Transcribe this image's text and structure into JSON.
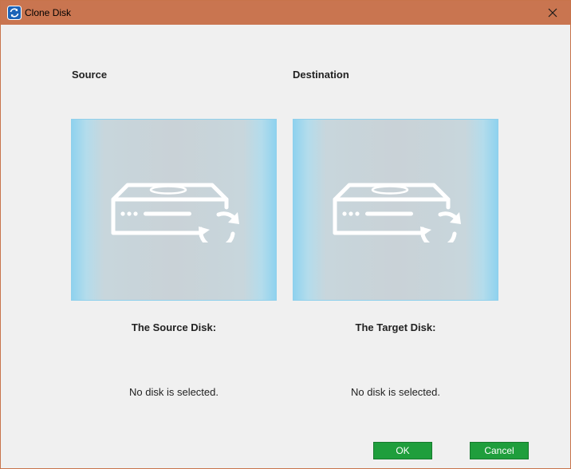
{
  "window": {
    "title": "Clone Disk"
  },
  "source": {
    "heading": "Source",
    "disk_label": "The Source Disk:",
    "status": "No disk is selected."
  },
  "destination": {
    "heading": "Destination",
    "disk_label": "The Target Disk:",
    "status": "No disk is selected."
  },
  "buttons": {
    "ok": "OK",
    "cancel": "Cancel"
  },
  "icons": {
    "app": "clone-disk-app-icon",
    "close": "close-icon",
    "disk": "hard-disk-sync-icon"
  },
  "colors": {
    "titlebar": "#c97550",
    "button": "#1f9e3c",
    "panel_edge": "#8fd2ee"
  }
}
